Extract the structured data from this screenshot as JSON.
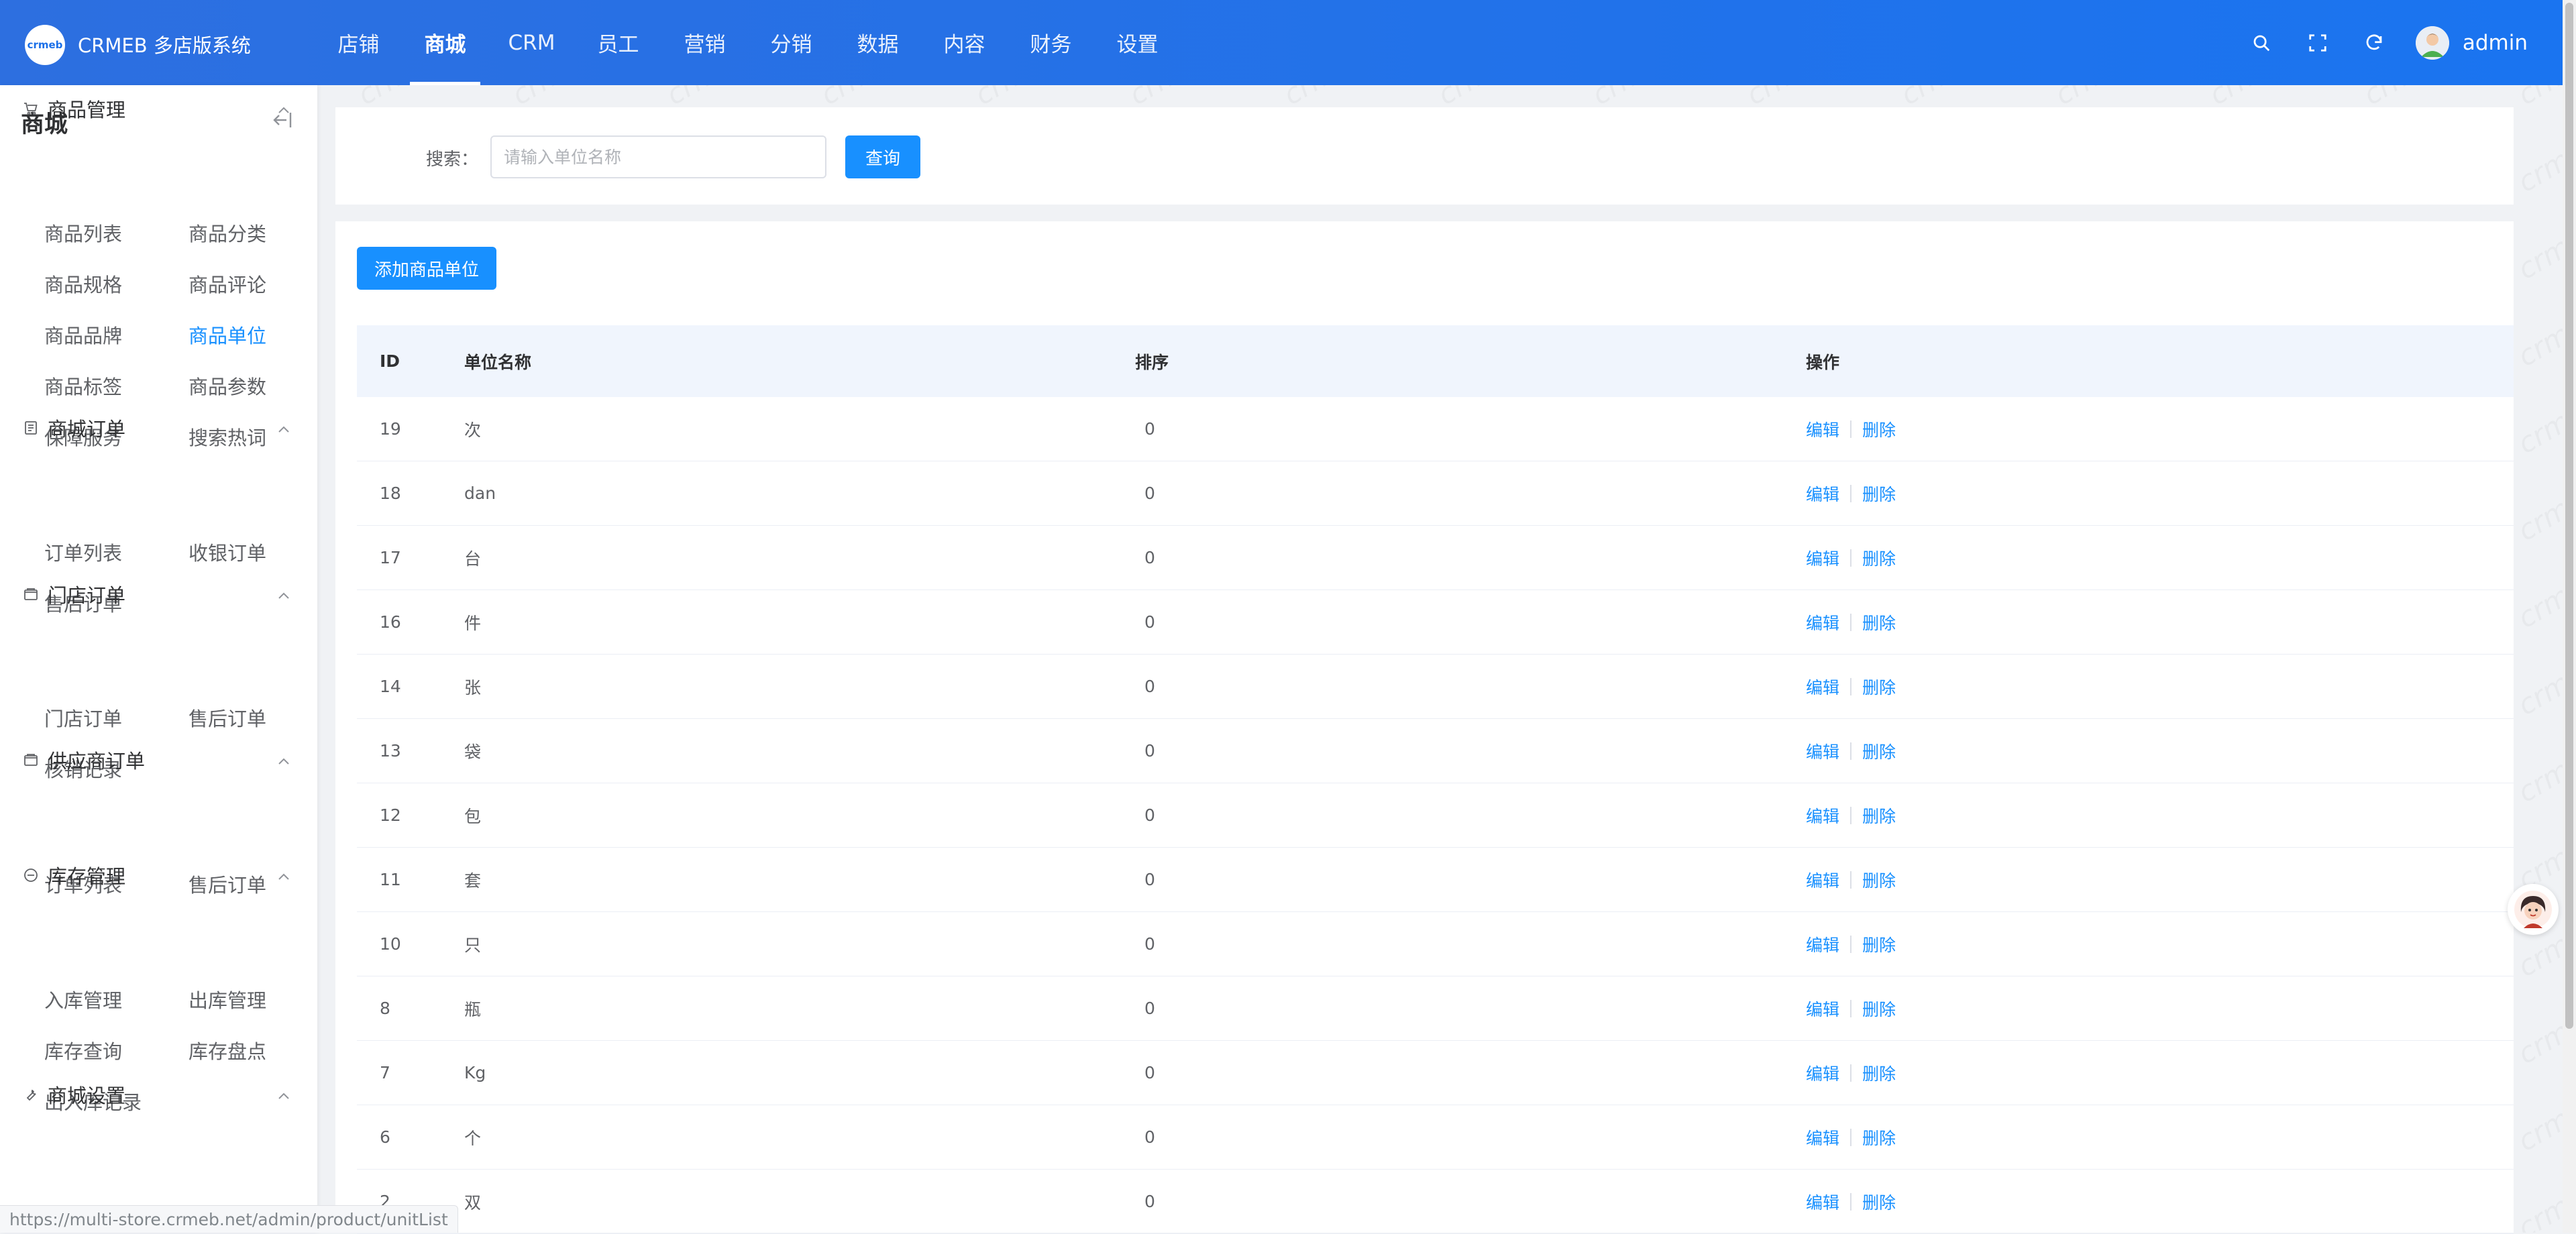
{
  "app": {
    "logo_text": "crmeb",
    "brand": "CRMEB 多店版系统"
  },
  "topnav": [
    {
      "label": "店铺"
    },
    {
      "label": "商城",
      "active": true
    },
    {
      "label": "CRM"
    },
    {
      "label": "员工"
    },
    {
      "label": "营销"
    },
    {
      "label": "分销"
    },
    {
      "label": "数据"
    },
    {
      "label": "内容"
    },
    {
      "label": "财务"
    },
    {
      "label": "设置"
    }
  ],
  "header": {
    "icons": [
      "search-icon",
      "fullscreen-icon",
      "refresh-icon"
    ],
    "username": "admin"
  },
  "sidebar": {
    "title": "商城",
    "groups": [
      {
        "label": "商品管理",
        "icon": "cart-icon",
        "items": [
          "商品列表",
          "商品分类",
          "商品规格",
          "商品评论",
          "商品品牌",
          "商品单位",
          "商品标签",
          "商品参数",
          "保障服务",
          "搜索热词"
        ]
      },
      {
        "label": "商城订单",
        "icon": "document-icon",
        "items": [
          "订单列表",
          "收银订单",
          "售后订单"
        ]
      },
      {
        "label": "门店订单",
        "icon": "wallet-icon",
        "items": [
          "门店订单",
          "售后订单",
          "核销记录"
        ]
      },
      {
        "label": "供应商订单",
        "icon": "wallet-icon",
        "items": [
          "订单列表",
          "售后订单"
        ]
      },
      {
        "label": "库存管理",
        "icon": "inventory-icon",
        "items": [
          "入库管理",
          "出库管理",
          "库存查询",
          "库存盘点",
          "出入库记录"
        ]
      },
      {
        "label": "商城设置",
        "icon": "wrench-icon",
        "items": []
      }
    ],
    "active_item": "商品单位"
  },
  "search": {
    "label": "搜索：",
    "placeholder": "请输入单位名称",
    "button": "查询"
  },
  "toolbar": {
    "add_button": "添加商品单位"
  },
  "table": {
    "columns": [
      "ID",
      "单位名称",
      "排序",
      "操作"
    ],
    "rows": [
      {
        "id": "19",
        "name": "次",
        "sort": "0"
      },
      {
        "id": "18",
        "name": "dan",
        "sort": "0"
      },
      {
        "id": "17",
        "name": "台",
        "sort": "0"
      },
      {
        "id": "16",
        "name": "件",
        "sort": "0"
      },
      {
        "id": "14",
        "name": "张",
        "sort": "0"
      },
      {
        "id": "13",
        "name": "袋",
        "sort": "0"
      },
      {
        "id": "12",
        "name": "包",
        "sort": "0"
      },
      {
        "id": "11",
        "name": "套",
        "sort": "0"
      },
      {
        "id": "10",
        "name": "只",
        "sort": "0"
      },
      {
        "id": "8",
        "name": "瓶",
        "sort": "0"
      },
      {
        "id": "7",
        "name": "Kg",
        "sort": "0"
      },
      {
        "id": "6",
        "name": "个",
        "sort": "0"
      },
      {
        "id": "2",
        "name": "双",
        "sort": "0"
      }
    ],
    "actions": {
      "edit": "编辑",
      "delete": "删除"
    }
  },
  "watermark_text": "crmeb",
  "status_url": "https://multi-store.crmeb.net/admin/product/unitList",
  "colors": {
    "header": "#1a74f0",
    "accent": "#1890ff",
    "table_header_bg": "#f0f5fd"
  }
}
